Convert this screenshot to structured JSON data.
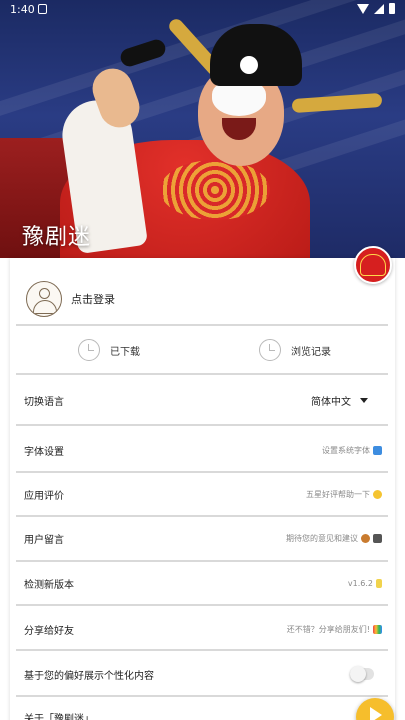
{
  "status_bar": {
    "time": "1:40"
  },
  "header": {
    "title": "豫剧迷"
  },
  "login": {
    "label": "点击登录"
  },
  "quick_actions": [
    {
      "label": "已下载",
      "icon": "clock-icon"
    },
    {
      "label": "浏览记录",
      "icon": "clock-icon"
    }
  ],
  "settings": [
    {
      "label": "切换语言",
      "value": "简体中文"
    },
    {
      "label": "字体设置",
      "value": "设置系统字体"
    },
    {
      "label": "应用评价",
      "value": "五星好评帮助一下"
    },
    {
      "label": "用户留言",
      "value": "期待您的意见和建议"
    },
    {
      "label": "检测新版本",
      "value": "v1.6.2"
    },
    {
      "label": "分享给好友",
      "value": "还不错？分享给朋友们!"
    },
    {
      "label": "基于您的偏好展示个性化内容",
      "value": ""
    }
  ],
  "about": {
    "label": "关于「豫剧迷」"
  },
  "colors": {
    "accent": "#f6be2c",
    "badge_red": "#d61f1f",
    "divider": "#d9d9d9"
  }
}
